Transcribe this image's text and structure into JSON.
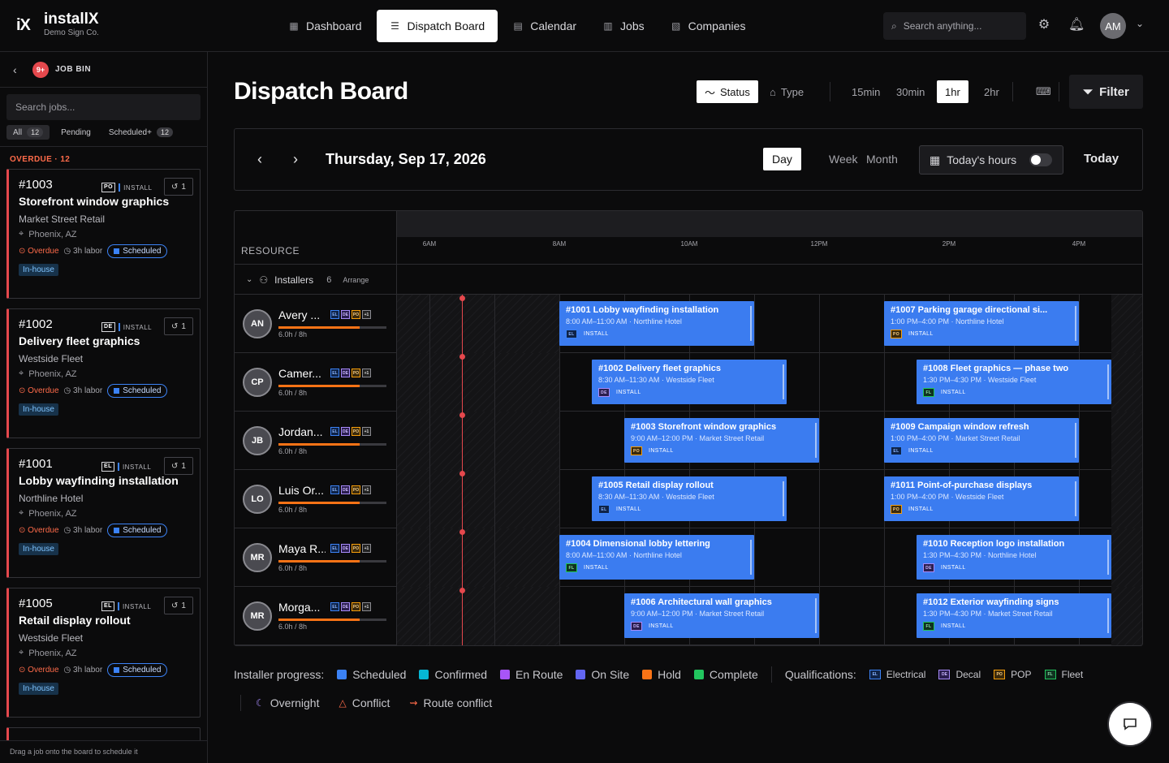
{
  "app": {
    "brand": "installX",
    "logo_mark": "iX",
    "company": "Demo Sign Co."
  },
  "nav": [
    {
      "label": "Dashboard",
      "icon": "dashboard-icon",
      "active": false
    },
    {
      "label": "Dispatch Board",
      "icon": "list-icon",
      "active": true
    },
    {
      "label": "Calendar",
      "icon": "calendar-icon",
      "active": false
    },
    {
      "label": "Jobs",
      "icon": "briefcase-icon",
      "active": false
    },
    {
      "label": "Companies",
      "icon": "building-icon",
      "active": false
    }
  ],
  "header": {
    "search_placeholder": "Search anything...",
    "avatar": "AM"
  },
  "job_bin": {
    "title": "JOB BIN",
    "badge": "9+",
    "search_placeholder": "Search jobs...",
    "filters": [
      {
        "label": "All",
        "count": "12",
        "active": true
      },
      {
        "label": "Pending",
        "count": "",
        "active": false
      },
      {
        "label": "Scheduled+",
        "count": "12",
        "active": false
      }
    ],
    "section": "OVERDUE · 12",
    "footer": "Drag a job onto the board to schedule it",
    "cards": [
      {
        "num": "#1003",
        "qual": "PO",
        "type": "INSTALL",
        "hist": "1",
        "title": "Storefront window graphics",
        "client": "Market Street Retail",
        "loc": "Phoenix, AZ",
        "overdue": "Overdue",
        "labor": "3h labor",
        "status": "Scheduled",
        "crew": "In-house"
      },
      {
        "num": "#1002",
        "qual": "DE",
        "type": "INSTALL",
        "hist": "1",
        "title": "Delivery fleet graphics",
        "client": "Westside Fleet",
        "loc": "Phoenix, AZ",
        "overdue": "Overdue",
        "labor": "3h labor",
        "status": "Scheduled",
        "crew": "In-house"
      },
      {
        "num": "#1001",
        "qual": "EL",
        "type": "INSTALL",
        "hist": "1",
        "title": "Lobby wayfinding installation",
        "client": "Northline Hotel",
        "loc": "Phoenix, AZ",
        "overdue": "Overdue",
        "labor": "3h labor",
        "status": "Scheduled",
        "crew": "In-house"
      },
      {
        "num": "#1005",
        "qual": "EL",
        "type": "INSTALL",
        "hist": "1",
        "title": "Retail display rollout",
        "client": "Westside Fleet",
        "loc": "Phoenix, AZ",
        "overdue": "Overdue",
        "labor": "3h labor",
        "status": "Scheduled",
        "crew": "In-house"
      }
    ]
  },
  "page": {
    "title": "Dispatch Board",
    "tools": {
      "status": "Status",
      "type": "Type",
      "intervals": [
        "15min",
        "30min",
        "1hr",
        "2hr"
      ],
      "active_interval": "1hr",
      "filter": "Filter"
    },
    "date": "Thursday, Sep 17, 2026",
    "views": [
      "Day",
      "Week",
      "Month"
    ],
    "active_view": "Day",
    "todays_hours": "Today's hours",
    "todays_hours_on": false,
    "today": "Today"
  },
  "board": {
    "resource_label": "RESOURCE",
    "ticks": [
      "6AM",
      "8AM",
      "10AM",
      "12PM",
      "2PM",
      "4PM"
    ],
    "group": {
      "label": "Installers",
      "count": "6",
      "action": "Arrange"
    },
    "resources": [
      {
        "initials": "AN",
        "name": "Avery ...",
        "load": "6.0h / 8h",
        "load_fraction": 0.75,
        "quals": [
          "EL",
          "DE",
          "PO",
          "+1"
        ],
        "events": [
          {
            "title": "#1001 Lobby wayfinding installation",
            "sub": "8:00 AM–11:00 AM · Northline Hotel",
            "qual": "EL",
            "type": "INSTALL",
            "start": 8,
            "end": 11
          },
          {
            "title": "#1007 Parking garage directional si...",
            "sub": "1:00 PM–4:00 PM · Northline Hotel",
            "qual": "PO",
            "type": "INSTALL",
            "start": 13,
            "end": 16
          }
        ]
      },
      {
        "initials": "CP",
        "name": "Camer...",
        "load": "6.0h / 8h",
        "load_fraction": 0.75,
        "quals": [
          "EL",
          "DE",
          "PO",
          "+1"
        ],
        "events": [
          {
            "title": "#1002 Delivery fleet graphics",
            "sub": "8:30 AM–11:30 AM · Westside Fleet",
            "qual": "DE",
            "type": "INSTALL",
            "start": 8.5,
            "end": 11.5
          },
          {
            "title": "#1008 Fleet graphics — phase two",
            "sub": "1:30 PM–4:30 PM · Westside Fleet",
            "qual": "FL",
            "type": "INSTALL",
            "start": 13.5,
            "end": 16.5
          }
        ]
      },
      {
        "initials": "JB",
        "name": "Jordan...",
        "load": "6.0h / 8h",
        "load_fraction": 0.75,
        "quals": [
          "EL",
          "DE",
          "PO",
          "+1"
        ],
        "events": [
          {
            "title": "#1003 Storefront window graphics",
            "sub": "9:00 AM–12:00 PM · Market Street Retail",
            "qual": "PO",
            "type": "INSTALL",
            "start": 9,
            "end": 12
          },
          {
            "title": "#1009 Campaign window refresh",
            "sub": "1:00 PM–4:00 PM · Market Street Retail",
            "qual": "EL",
            "type": "INSTALL",
            "start": 13,
            "end": 16
          }
        ]
      },
      {
        "initials": "LO",
        "name": "Luis Or...",
        "load": "6.0h / 8h",
        "load_fraction": 0.75,
        "quals": [
          "EL",
          "DE",
          "PO",
          "+1"
        ],
        "events": [
          {
            "title": "#1005 Retail display rollout",
            "sub": "8:30 AM–11:30 AM · Westside Fleet",
            "qual": "EL",
            "type": "INSTALL",
            "start": 8.5,
            "end": 11.5
          },
          {
            "title": "#1011 Point-of-purchase displays",
            "sub": "1:00 PM–4:00 PM · Westside Fleet",
            "qual": "PO",
            "type": "INSTALL",
            "start": 13,
            "end": 16
          }
        ]
      },
      {
        "initials": "MR",
        "name": "Maya R...",
        "load": "6.0h / 8h",
        "load_fraction": 0.75,
        "quals": [
          "EL",
          "DE",
          "PO",
          "+1"
        ],
        "events": [
          {
            "title": "#1004 Dimensional lobby lettering",
            "sub": "8:00 AM–11:00 AM · Northline Hotel",
            "qual": "FL",
            "type": "INSTALL",
            "start": 8,
            "end": 11
          },
          {
            "title": "#1010 Reception logo installation",
            "sub": "1:30 PM–4:30 PM · Northline Hotel",
            "qual": "DE",
            "type": "INSTALL",
            "start": 13.5,
            "end": 16.5
          }
        ]
      },
      {
        "initials": "MR",
        "name": "Morga...",
        "load": "6.0h / 8h",
        "load_fraction": 0.75,
        "quals": [
          "EL",
          "DE",
          "PO",
          "+1"
        ],
        "events": [
          {
            "title": "#1006 Architectural wall graphics",
            "sub": "9:00 AM–12:00 PM · Market Street Retail",
            "qual": "DE",
            "type": "INSTALL",
            "start": 9,
            "end": 12
          },
          {
            "title": "#1012 Exterior wayfinding signs",
            "sub": "1:30 PM–4:30 PM · Market Street Retail",
            "qual": "FL",
            "type": "INSTALL",
            "start": 13.5,
            "end": 16.5
          }
        ]
      }
    ]
  },
  "legend": {
    "progress_label": "Installer progress:",
    "statuses": [
      {
        "label": "Scheduled",
        "color": "#3b82f6"
      },
      {
        "label": "Confirmed",
        "color": "#06b6d4"
      },
      {
        "label": "En Route",
        "color": "#a855f7"
      },
      {
        "label": "On Site",
        "color": "#6366f1"
      },
      {
        "label": "Hold",
        "color": "#f97316"
      },
      {
        "label": "Complete",
        "color": "#22c55e"
      }
    ],
    "qual_label": "Qualifications:",
    "quals": [
      {
        "code": "EL",
        "label": "Electrical"
      },
      {
        "code": "DE",
        "label": "Decal"
      },
      {
        "code": "PO",
        "label": "POP"
      },
      {
        "code": "FL",
        "label": "Fleet"
      }
    ],
    "markers": [
      {
        "label": "Overnight",
        "icon": "moon-icon"
      },
      {
        "label": "Conflict",
        "icon": "warning-icon"
      },
      {
        "label": "Route conflict",
        "icon": "route-icon"
      }
    ]
  }
}
